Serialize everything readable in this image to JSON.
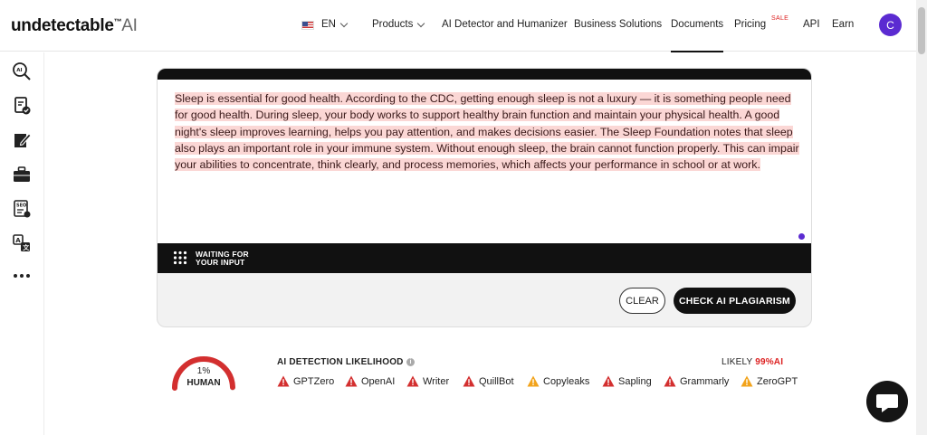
{
  "header": {
    "logo": {
      "brand": "undetectable",
      "tm": "™",
      "ai": "AI"
    },
    "language": "EN",
    "nav": [
      {
        "label": "Products",
        "dropdown": true
      },
      {
        "label": "AI Detector and Humanizer"
      },
      {
        "label": "Business Solutions"
      },
      {
        "label": "Documents",
        "active": true
      },
      {
        "label": "Pricing"
      },
      {
        "label": "API"
      },
      {
        "label": "Earn"
      }
    ],
    "sale_badge": "SALE",
    "avatar_initial": "C"
  },
  "sidebar": {
    "icons": [
      "ai-search-icon",
      "document-check-icon",
      "edit-note-icon",
      "briefcase-icon",
      "seo-report-icon",
      "translate-icon",
      "more-icon"
    ]
  },
  "editor": {
    "text": "Sleep is essential for good health. According to the CDC, getting enough sleep is not a luxury — it is something people need for good health. During sleep, your body works to support healthy brain function and maintain your physical health. A good night's sleep improves learning, helps you pay attention, and makes decisions easier. The Sleep Foundation notes that sleep also plays an important role in your immune system. Without enough sleep, the brain cannot function properly. This can impair your abilities to concentrate, think clearly, and process memories, which affects your performance in school or at work.",
    "status_line1": "WAITING FOR",
    "status_line2": "YOUR INPUT",
    "clear_label": "CLEAR",
    "check_label": "CHECK AI PLAGIARISM"
  },
  "result": {
    "human_percent": "1%",
    "human_label": "HUMAN",
    "gauge_fraction": 0.01,
    "detection_title": "AI DETECTION LIKELIHOOD",
    "likely_prefix": "LIKELY",
    "likely_value": "99%AI",
    "detectors": [
      {
        "name": "GPTZero",
        "status": "red"
      },
      {
        "name": "OpenAI",
        "status": "red"
      },
      {
        "name": "Writer",
        "status": "red"
      },
      {
        "name": "QuillBot",
        "status": "red"
      },
      {
        "name": "Copyleaks",
        "status": "orange"
      },
      {
        "name": "Sapling",
        "status": "red"
      },
      {
        "name": "Grammarly",
        "status": "red"
      },
      {
        "name": "ZeroGPT",
        "status": "orange"
      }
    ],
    "colors": {
      "red": "#d32f2f",
      "orange": "#f2a31b"
    }
  }
}
